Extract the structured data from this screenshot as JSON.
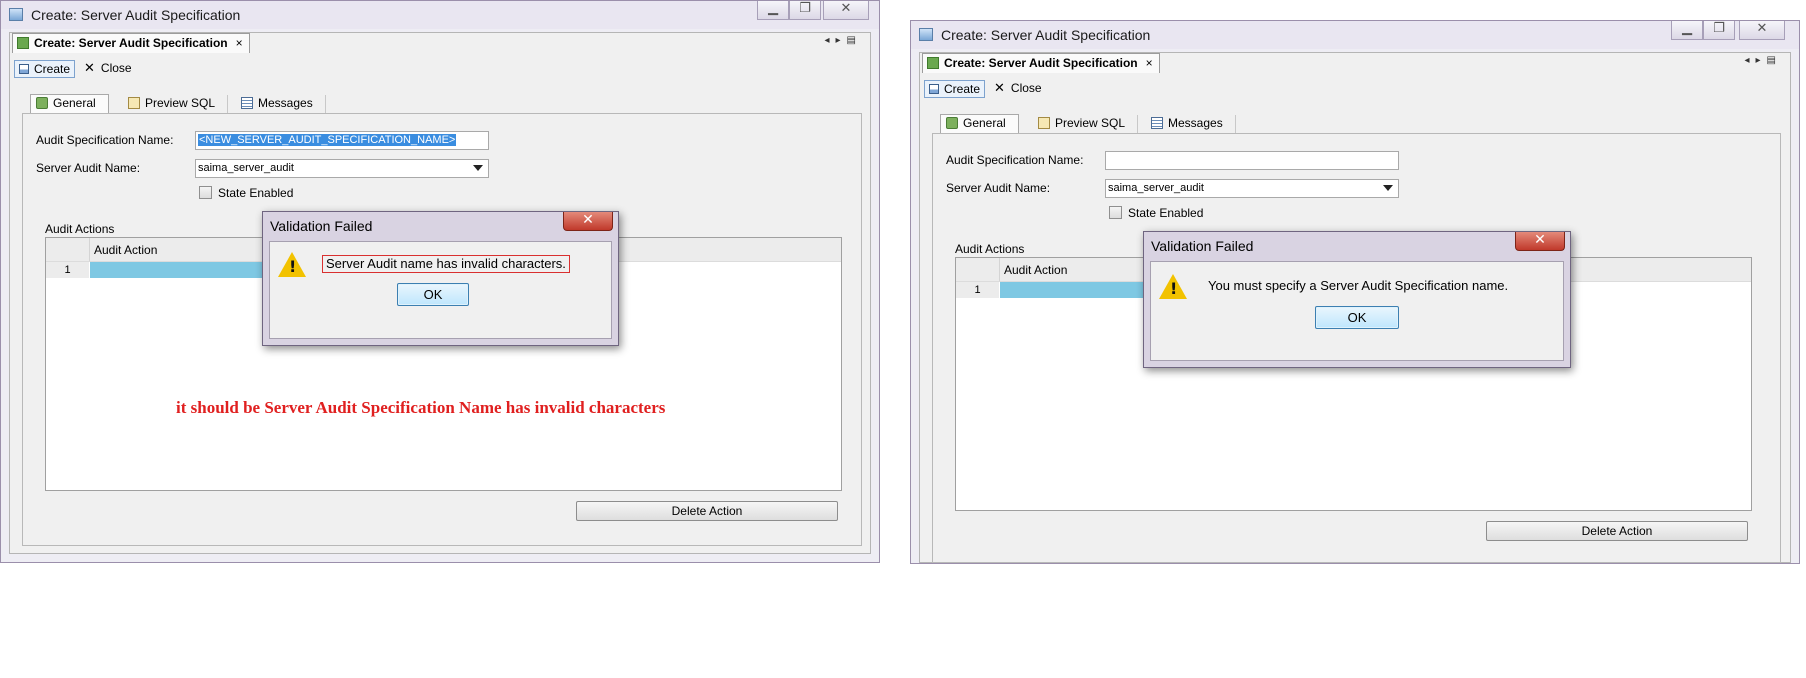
{
  "colors": {
    "annotation": "#e02020",
    "selection": "#3a8de0",
    "grid_cell": "#7ec8e3",
    "warning": "#f2c200"
  },
  "left": {
    "window": {
      "title": "Create: Server Audit Specification"
    },
    "document_tab": {
      "label": "Create: Server Audit Specification",
      "close": "×"
    },
    "toolbar": {
      "create_label": "Create",
      "close_label": "Close"
    },
    "tabs": [
      {
        "label": "General",
        "icon": "general-icon"
      },
      {
        "label": "Preview SQL",
        "icon": "sql-icon"
      },
      {
        "label": "Messages",
        "icon": "messages-icon"
      }
    ],
    "form": {
      "spec_name_label": "Audit Specification Name:",
      "spec_name_value": "<NEW_SERVER_AUDIT_SPECIFICATION_NAME>",
      "audit_name_label": "Server Audit Name:",
      "audit_name_value": "saima_server_audit",
      "state_enabled_label": "State Enabled"
    },
    "audit_actions": {
      "label": "Audit Actions",
      "column": "Audit Action",
      "rows": [
        {
          "num": "1"
        }
      ]
    },
    "delete_button": "Delete Action",
    "dialog": {
      "title": "Validation Failed",
      "message": "Server Audit name has invalid characters.",
      "ok": "OK",
      "close": "✕"
    },
    "annotation": "it should be Server Audit Specification Name has invalid characters"
  },
  "right": {
    "window": {
      "title": "Create: Server Audit Specification"
    },
    "document_tab": {
      "label": "Create: Server Audit Specification",
      "close": "×"
    },
    "toolbar": {
      "create_label": "Create",
      "close_label": "Close"
    },
    "tabs": [
      {
        "label": "General",
        "icon": "general-icon"
      },
      {
        "label": "Preview SQL",
        "icon": "sql-icon"
      },
      {
        "label": "Messages",
        "icon": "messages-icon"
      }
    ],
    "form": {
      "spec_name_label": "Audit Specification Name:",
      "spec_name_value": "",
      "audit_name_label": "Server Audit Name:",
      "audit_name_value": "saima_server_audit",
      "state_enabled_label": "State Enabled"
    },
    "audit_actions": {
      "label": "Audit Actions",
      "column": "Audit Action",
      "rows": [
        {
          "num": "1"
        }
      ]
    },
    "delete_button": "Delete Action",
    "dialog": {
      "title": "Validation Failed",
      "message": "You must specify a Server Audit Specification name.",
      "ok": "OK",
      "close": "✕"
    }
  }
}
